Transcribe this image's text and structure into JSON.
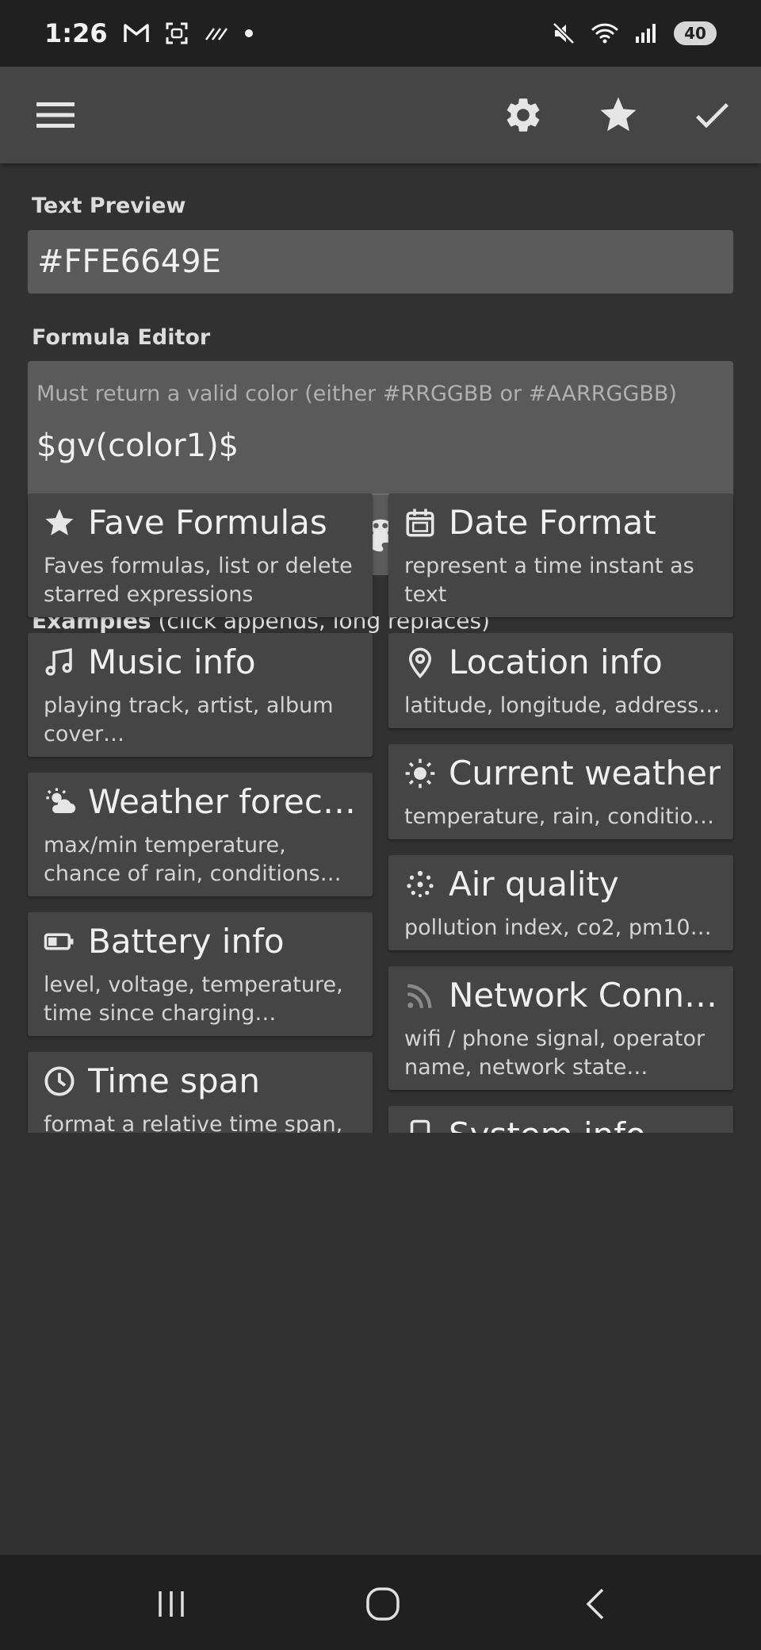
{
  "status_bar": {
    "time": "1:26",
    "battery": "40",
    "icons": [
      "gmail-icon",
      "screenshot-icon",
      "signal-stripes-icon",
      "dot-icon",
      "mute-icon",
      "wifi-icon",
      "cellular-icon",
      "battery-icon"
    ]
  },
  "toolbar": {
    "icons": [
      "menu-icon",
      "settings-icon",
      "star-icon",
      "check-icon"
    ]
  },
  "text_preview": {
    "label": "Text Preview",
    "value": "#FFE6649E"
  },
  "formula_editor": {
    "label": "Formula Editor",
    "placeholder": "Must return a valid color (either #RRGGBB or #AARRGGBB)",
    "value": "$gv(color1)$",
    "tools": [
      "globe-icon",
      "palette-icon",
      "star-icon"
    ]
  },
  "examples": {
    "label_bold": "Examples",
    "label_rest": " (click appends, long replaces)",
    "left": [
      {
        "icon": "star-icon",
        "title": "Fave Formulas",
        "desc": "Faves formulas, list or delete starred expressions"
      },
      {
        "icon": "music-note-icon",
        "title": "Music info",
        "desc": "playing track, artist, album cover…"
      },
      {
        "icon": "partly-cloudy-icon",
        "title": "Weather forecast",
        "desc": "max/min temperature, chance of rain, conditions…"
      },
      {
        "icon": "battery-icon",
        "title": "Battery info",
        "desc": "level, voltage, temperature, time since charging…"
      },
      {
        "icon": "clock-icon",
        "title": "Time span",
        "desc": "format a relative time span,"
      }
    ],
    "right": [
      {
        "icon": "calendar-icon",
        "title": "Date Format",
        "desc": "represent a time instant as text"
      },
      {
        "icon": "location-pin-icon",
        "title": "Location info",
        "desc": "latitude, longitude, address…"
      },
      {
        "icon": "sun-icon",
        "title": "Current weather",
        "desc": "temperature, rain, conditions…"
      },
      {
        "icon": "air-quality-icon",
        "title": "Air quality",
        "desc": "pollution index, co2, pm10…"
      },
      {
        "icon": "rss-signal-icon",
        "title": "Network Connectivity",
        "desc": "wifi / phone signal, operator name, network state…"
      },
      {
        "icon": "phone-icon",
        "title": "System info",
        "desc": ""
      }
    ]
  },
  "nav_bar": {
    "icons": [
      "recents-icon",
      "home-icon",
      "back-icon"
    ]
  }
}
